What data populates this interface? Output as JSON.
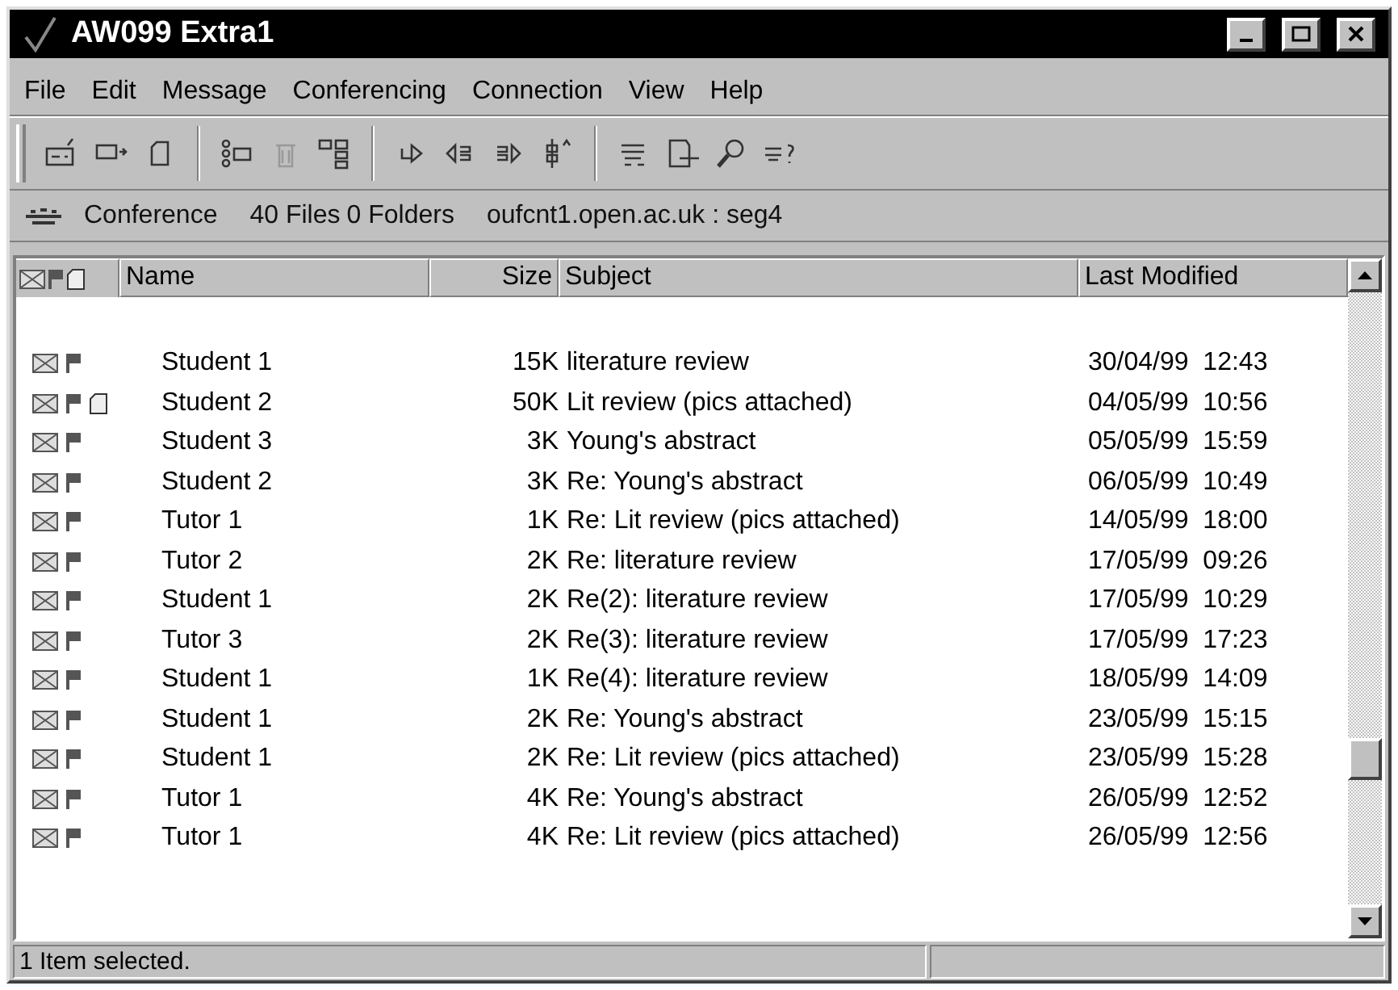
{
  "window": {
    "title": "AW099 Extra1"
  },
  "menu": [
    "File",
    "Edit",
    "Message",
    "Conferencing",
    "Connection",
    "View",
    "Help"
  ],
  "location": {
    "label": "Conference",
    "files": "40 Files",
    "folders": "0 Folders",
    "path": "oufcnt1.open.ac.uk : seg4"
  },
  "table": {
    "columns": [
      "Name",
      "Size",
      "Subject",
      "Last Modified"
    ],
    "rows": [
      {
        "name": "Student 1",
        "size": "15K",
        "subject": "literature review",
        "modified": "30/04/99  12:43",
        "attachment": false
      },
      {
        "name": "Student 2",
        "size": "50K",
        "subject": "Lit review (pics attached)",
        "modified": "04/05/99  10:56",
        "attachment": true
      },
      {
        "name": "Student 3",
        "size": "3K",
        "subject": "Young's abstract",
        "modified": "05/05/99  15:59",
        "attachment": false
      },
      {
        "name": "Student 2",
        "size": "3K",
        "subject": "Re: Young's abstract",
        "modified": "06/05/99  10:49",
        "attachment": false
      },
      {
        "name": "Tutor 1",
        "size": "1K",
        "subject": "Re: Lit review (pics attached)",
        "modified": "14/05/99  18:00",
        "attachment": false
      },
      {
        "name": "Tutor 2",
        "size": "2K",
        "subject": "Re: literature review",
        "modified": "17/05/99  09:26",
        "attachment": false
      },
      {
        "name": "Student 1",
        "size": "2K",
        "subject": "Re(2): literature review",
        "modified": "17/05/99  10:29",
        "attachment": false
      },
      {
        "name": "Tutor 3",
        "size": "2K",
        "subject": "Re(3): literature review",
        "modified": "17/05/99  17:23",
        "attachment": false
      },
      {
        "name": "Student 1",
        "size": "1K",
        "subject": "Re(4): literature review",
        "modified": "18/05/99  14:09",
        "attachment": false
      },
      {
        "name": "Student 1",
        "size": "2K",
        "subject": "Re: Young's abstract",
        "modified": "23/05/99  15:15",
        "attachment": false
      },
      {
        "name": "Student 1",
        "size": "2K",
        "subject": "Re: Lit review (pics attached)",
        "modified": "23/05/99  15:28",
        "attachment": false
      },
      {
        "name": "Tutor 1",
        "size": "4K",
        "subject": "Re: Young's abstract",
        "modified": "26/05/99  12:52",
        "attachment": false
      },
      {
        "name": "Tutor 1",
        "size": "4K",
        "subject": "Re: Lit review (pics attached)",
        "modified": "26/05/99  12:56",
        "attachment": false
      }
    ]
  },
  "status_bar": "1 Item selected."
}
